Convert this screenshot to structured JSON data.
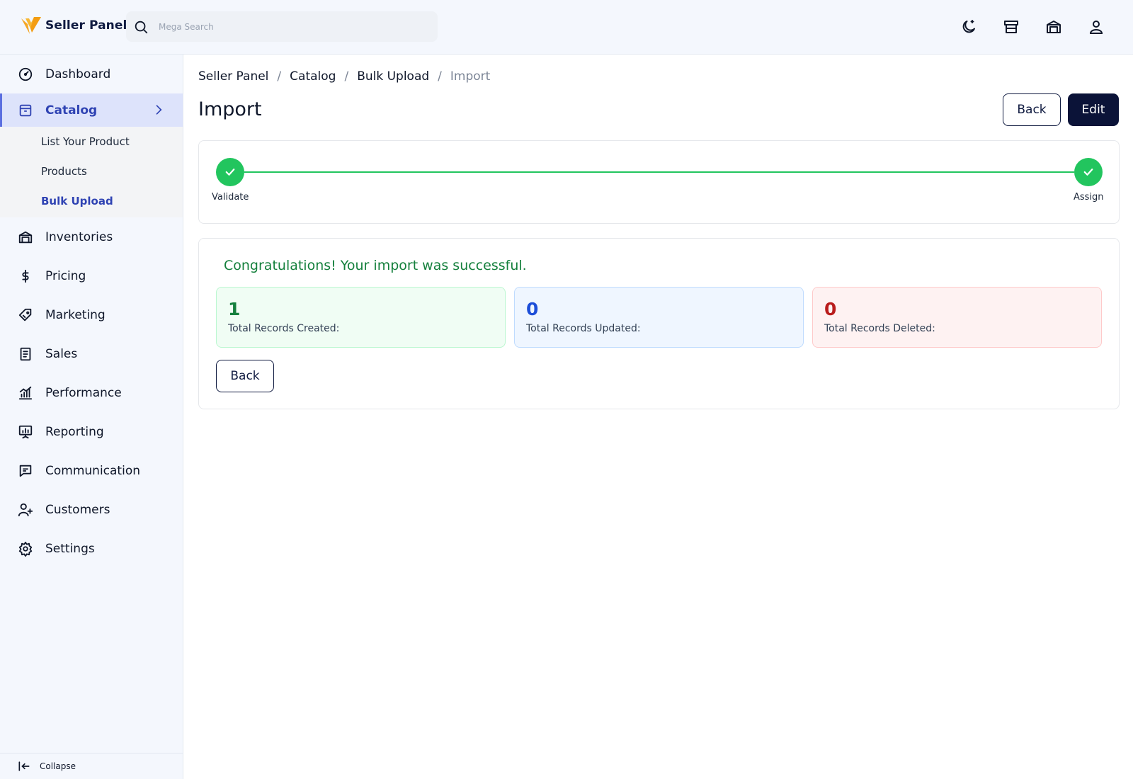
{
  "header": {
    "brand_name": "Seller Panel",
    "search_placeholder": "Mega Search",
    "icons": [
      "theme-toggle-icon",
      "storefront-icon",
      "warehouse-icon",
      "user-icon"
    ]
  },
  "sidebar": {
    "items": [
      {
        "label": "Dashboard",
        "icon": "dashboard-gauge-icon"
      },
      {
        "label": "Catalog",
        "icon": "catalog-icon",
        "active": true
      },
      {
        "label": "Inventories",
        "icon": "inventories-icon"
      },
      {
        "label": "Pricing",
        "icon": "dollar-icon"
      },
      {
        "label": "Marketing",
        "icon": "tag-icon"
      },
      {
        "label": "Sales",
        "icon": "receipt-icon"
      },
      {
        "label": "Performance",
        "icon": "bar-chart-icon"
      },
      {
        "label": "Reporting",
        "icon": "presentation-chart-icon"
      },
      {
        "label": "Communication",
        "icon": "chat-icon"
      },
      {
        "label": "Customers",
        "icon": "customers-icon"
      },
      {
        "label": "Settings",
        "icon": "gear-icon"
      }
    ],
    "catalog_sub": [
      {
        "label": "List Your Product"
      },
      {
        "label": "Products"
      },
      {
        "label": "Bulk Upload",
        "active": true
      }
    ],
    "collapse_label": "Collapse"
  },
  "breadcrumb": {
    "items": [
      "Seller Panel",
      "Catalog",
      "Bulk Upload",
      "Import"
    ],
    "separator": "/"
  },
  "page": {
    "title": "Import",
    "back_label": "Back",
    "edit_label": "Edit"
  },
  "stepper": {
    "steps": [
      {
        "label": "Validate",
        "status": "complete"
      },
      {
        "label": "Assign",
        "status": "complete"
      }
    ]
  },
  "result": {
    "message": "Congratulations! Your import was successful.",
    "stats": [
      {
        "value": "1",
        "label": "Total Records Created:"
      },
      {
        "value": "0",
        "label": "Total Records Updated:"
      },
      {
        "value": "0",
        "label": "Total Records Deleted:"
      }
    ],
    "back_label": "Back"
  },
  "colors": {
    "accent": "#2f43b3",
    "success": "#22c55e",
    "primary_button": "#0b1338"
  }
}
